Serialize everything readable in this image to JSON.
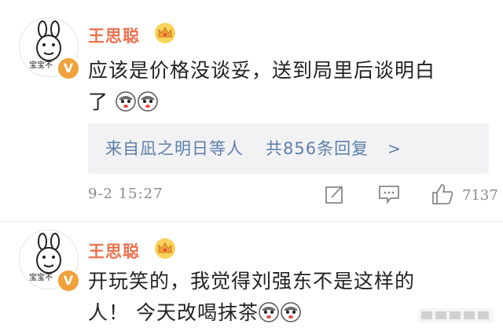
{
  "comments": [
    {
      "username": "王思聪",
      "avatar_caption": "宝宝不",
      "verified_badge": "V",
      "text_line1": "应该是价格没谈妥，送到局里后谈明白",
      "text_line2": "了",
      "replies_users": "来自凪之明日等人",
      "replies_count": "共856条回复",
      "replies_chevron": ">",
      "timestamp": "9-2 15:27",
      "likes": "7137"
    },
    {
      "username": "王思聪",
      "avatar_caption": "宝宝不",
      "verified_badge": "V",
      "text_line1": "开玩笑的，我觉得刘强东不是这样的",
      "text_line2": "人！ 今天改喝抹茶"
    }
  ],
  "icons": [
    "crown-icon",
    "verified-icon",
    "husky-emoji-icon",
    "edit-icon",
    "comment-icon",
    "like-icon"
  ],
  "colors": {
    "username": "#eb7350",
    "link": "#5d7fa8",
    "reply_bg": "#f2f2f5",
    "badge": "#f0a13a"
  }
}
